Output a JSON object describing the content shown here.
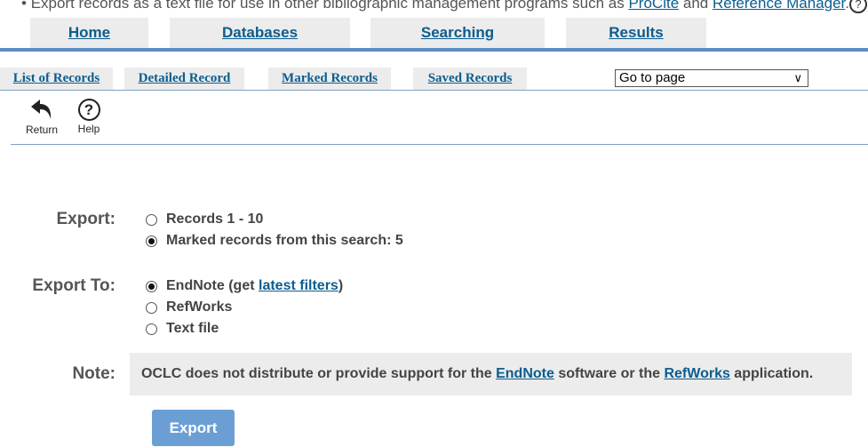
{
  "intro": {
    "text": "Export records as a text file for use in other bibliographic management programs such as ",
    "link1": "ProCite",
    "and": " and ",
    "link2": "Reference Manager",
    "end": "."
  },
  "nav": [
    "Home",
    "Databases",
    "Searching",
    "Results"
  ],
  "subnav": [
    "List of Records",
    "Detailed Record",
    "Marked Records",
    "Saved Records"
  ],
  "goto": "Go to page",
  "toolbar": {
    "return": "Return",
    "help": "Help"
  },
  "export": {
    "label": "Export:",
    "options": [
      {
        "label": "Records 1 - 10",
        "checked": false
      },
      {
        "label": "Marked records from this search: 5",
        "checked": true
      }
    ]
  },
  "export_to": {
    "label": "Export To:",
    "endnote": "EndNote (get ",
    "filters": "latest filters",
    "close": ")",
    "refworks": "RefWorks",
    "text": "Text file"
  },
  "note": {
    "label": "Note:",
    "t1": "OCLC does not distribute or provide support for the ",
    "l1": "EndNote",
    "t2": " software or the ",
    "l2": "RefWorks",
    "t3": " application."
  },
  "button": "Export"
}
